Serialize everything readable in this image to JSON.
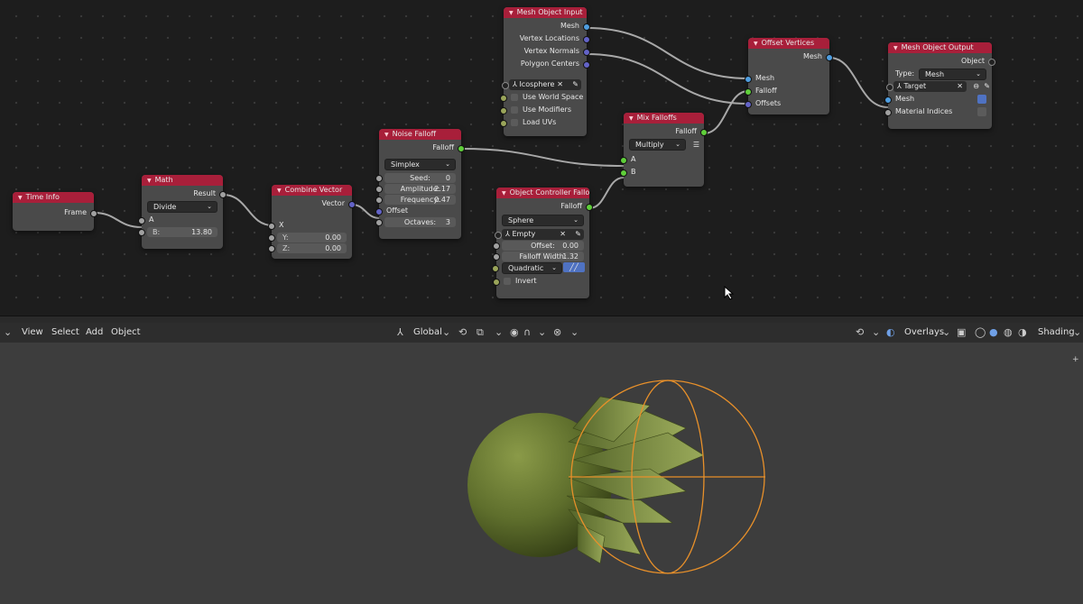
{
  "nodes": {
    "time_info": {
      "title": "Time Info",
      "output": "Frame"
    },
    "math": {
      "title": "Math",
      "output": "Result",
      "operation": "Divide",
      "input_a": "A",
      "b_label": "B:",
      "b_value": "13.80"
    },
    "combine_vector": {
      "title": "Combine Vector",
      "output": "Vector",
      "x_label": "X",
      "y_label": "Y:",
      "y_value": "0.00",
      "z_label": "Z:",
      "z_value": "0.00"
    },
    "noise_falloff": {
      "title": "Noise Falloff",
      "output": "Falloff",
      "type": "Simplex",
      "seed_label": "Seed:",
      "seed_value": "0",
      "amplitude_label": "Amplitude:",
      "amplitude_value": "2.17",
      "frequency_label": "Frequency:",
      "frequency_value": "0.47",
      "offset_label": "Offset",
      "octaves_label": "Octaves:",
      "octaves_value": "3"
    },
    "mesh_object_input": {
      "title": "Mesh Object Input",
      "outputs": [
        "Mesh",
        "Vertex Locations",
        "Vertex Normals",
        "Polygon Centers"
      ],
      "object": "Icosphere",
      "options": [
        "Use World Space",
        "Use Modifiers",
        "Load UVs"
      ]
    },
    "object_controller_falloff": {
      "title": "Object Controller Falloff",
      "output": "Falloff",
      "shape": "Sphere",
      "object": "Empty",
      "offset_label": "Offset:",
      "offset_value": "0.00",
      "width_label": "Falloff Width:",
      "width_value": "1.32",
      "interpolation": "Quadratic",
      "invert_label": "Invert"
    },
    "mix_falloffs": {
      "title": "Mix Falloffs",
      "output": "Falloff",
      "mode": "Multiply",
      "input_a": "A",
      "input_b": "B"
    },
    "offset_vertices": {
      "title": "Offset Vertices",
      "output": "Mesh",
      "inputs": [
        "Mesh",
        "Falloff",
        "Offsets"
      ]
    },
    "mesh_object_output": {
      "title": "Mesh Object Output",
      "output": "Object",
      "type_label": "Type:",
      "type_value": "Mesh",
      "target": "Target",
      "inputs": [
        "Mesh",
        "Material Indices"
      ]
    }
  },
  "viewport_header": {
    "menus": [
      "View",
      "Select",
      "Add",
      "Object"
    ],
    "orientation": "Global",
    "overlays": "Overlays",
    "shading": "Shading"
  },
  "colors": {
    "node_header": "#a81f3a",
    "node_body": "#4a4a4a",
    "mesh_green": "#6b7a35",
    "controller_orange": "#e8902a",
    "editor_bg": "#1d1d1d",
    "viewport_bg": "#3d3d3d"
  }
}
